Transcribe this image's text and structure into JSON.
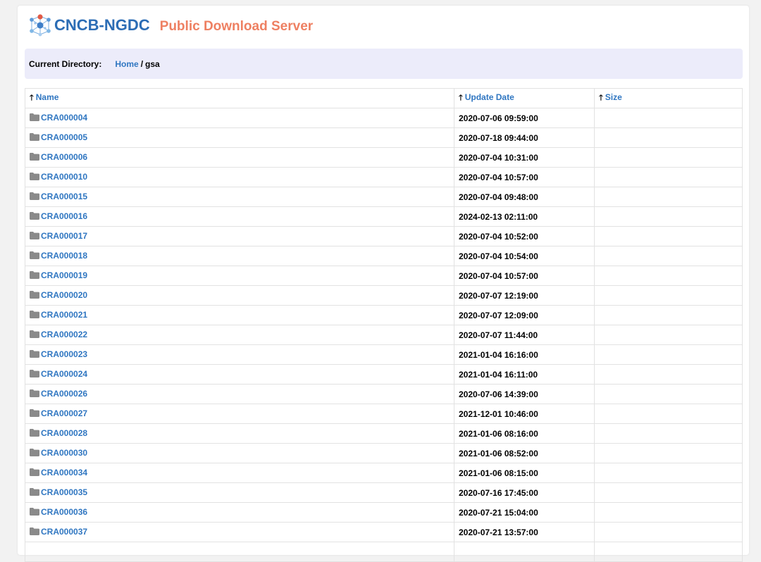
{
  "header": {
    "logo_text": "CNCB-NGDC",
    "subtitle": "Public Download Server"
  },
  "breadcrumb": {
    "label": "Current Directory:",
    "home": "Home",
    "separator": "/",
    "current": "gsa"
  },
  "table": {
    "columns": [
      {
        "label": "Name",
        "arrow": "🡑"
      },
      {
        "label": "Update Date",
        "arrow": "🡑"
      },
      {
        "label": "Size",
        "arrow": "🡑"
      }
    ],
    "rows": [
      {
        "name": "CRA000004",
        "date": "2020-07-06 09:59:00",
        "size": ""
      },
      {
        "name": "CRA000005",
        "date": "2020-07-18 09:44:00",
        "size": ""
      },
      {
        "name": "CRA000006",
        "date": "2020-07-04 10:31:00",
        "size": ""
      },
      {
        "name": "CRA000010",
        "date": "2020-07-04 10:57:00",
        "size": ""
      },
      {
        "name": "CRA000015",
        "date": "2020-07-04 09:48:00",
        "size": ""
      },
      {
        "name": "CRA000016",
        "date": "2024-02-13 02:11:00",
        "size": ""
      },
      {
        "name": "CRA000017",
        "date": "2020-07-04 10:52:00",
        "size": ""
      },
      {
        "name": "CRA000018",
        "date": "2020-07-04 10:54:00",
        "size": ""
      },
      {
        "name": "CRA000019",
        "date": "2020-07-04 10:57:00",
        "size": ""
      },
      {
        "name": "CRA000020",
        "date": "2020-07-07 12:19:00",
        "size": ""
      },
      {
        "name": "CRA000021",
        "date": "2020-07-07 12:09:00",
        "size": ""
      },
      {
        "name": "CRA000022",
        "date": "2020-07-07 11:44:00",
        "size": ""
      },
      {
        "name": "CRA000023",
        "date": "2021-01-04 16:16:00",
        "size": ""
      },
      {
        "name": "CRA000024",
        "date": "2021-01-04 16:11:00",
        "size": ""
      },
      {
        "name": "CRA000026",
        "date": "2020-07-06 14:39:00",
        "size": ""
      },
      {
        "name": "CRA000027",
        "date": "2021-12-01 10:46:00",
        "size": ""
      },
      {
        "name": "CRA000028",
        "date": "2021-01-06 08:16:00",
        "size": ""
      },
      {
        "name": "CRA000030",
        "date": "2021-01-06 08:52:00",
        "size": ""
      },
      {
        "name": "CRA000034",
        "date": "2021-01-06 08:15:00",
        "size": ""
      },
      {
        "name": "CRA000035",
        "date": "2020-07-16 17:45:00",
        "size": ""
      },
      {
        "name": "CRA000036",
        "date": "2020-07-21 15:04:00",
        "size": ""
      },
      {
        "name": "CRA000037",
        "date": "2020-07-21 13:57:00",
        "size": ""
      },
      {
        "name": "",
        "date": "",
        "size": ""
      }
    ]
  },
  "colors": {
    "link": "#2f76c1",
    "brand_blue": "#2c6db5",
    "brand_orange": "#ee8062",
    "breadcrumb_bg": "#ececfa"
  },
  "icons": {
    "logo": "molecule-network-icon",
    "folder": "folder-icon",
    "sort": "arrow-up-icon"
  }
}
